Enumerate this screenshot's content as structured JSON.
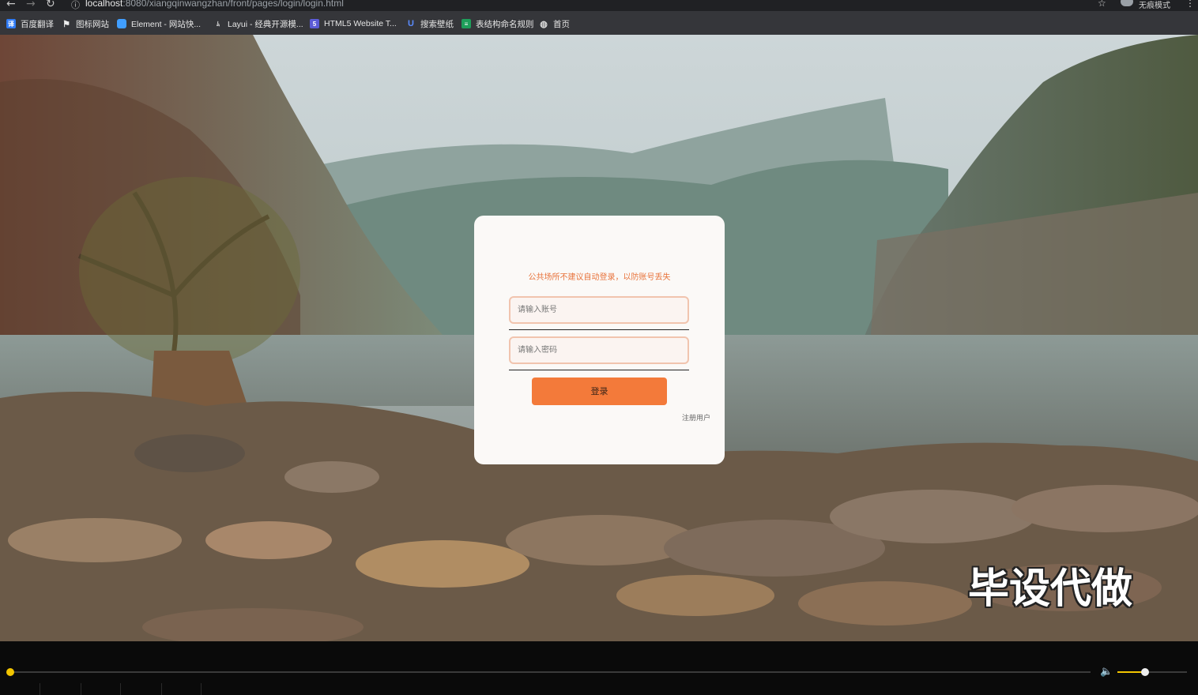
{
  "browser": {
    "url_host": "localhost",
    "url_path": ":8080/xiangqinwangzhan/front/pages/login/login.html",
    "incognito_label": "无痕模式",
    "bookmarks": [
      {
        "label": "百度翻译",
        "icon": "baidu-translate-icon",
        "color": "#2f7bf5"
      },
      {
        "label": "图标网站",
        "icon": "flag-icon",
        "color": "#444"
      },
      {
        "label": "Element - 网站快...",
        "icon": "element-icon",
        "color": "#409eff"
      },
      {
        "label": "Layui - 经典开源模...",
        "icon": "layui-icon",
        "color": "#666"
      },
      {
        "label": "HTML5 Website T...",
        "icon": "html5-icon",
        "color": "#5b5bd6"
      },
      {
        "label": "搜索壁纸",
        "icon": "wallpaper-icon",
        "color": "#3b6fd8"
      },
      {
        "label": "表结构命名规则",
        "icon": "table-icon",
        "color": "#1e9e5a"
      },
      {
        "label": "首页",
        "icon": "globe-icon",
        "color": "#888"
      }
    ]
  },
  "login": {
    "notice": "公共场所不建议自动登录，以防账号丢失",
    "account_placeholder": "请输入账号",
    "password_placeholder": "请输入密码",
    "login_button": "登录",
    "register_link": "注册用户"
  },
  "watermark": "毕设代做",
  "player": {
    "progress": 0.0,
    "volume": 0.4
  }
}
